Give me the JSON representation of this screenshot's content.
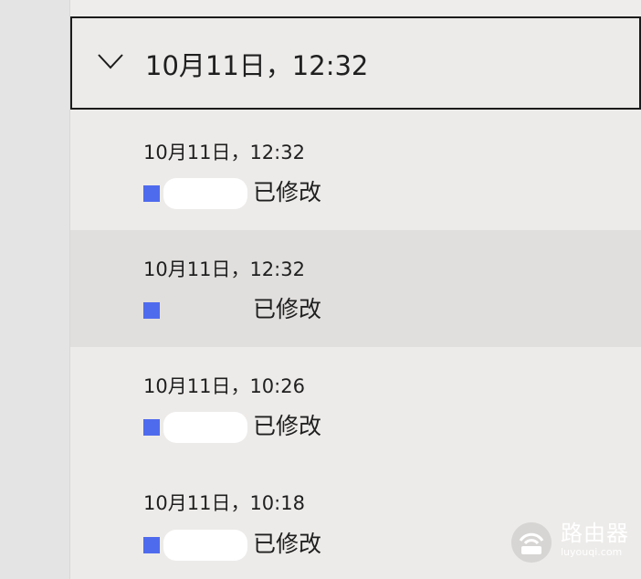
{
  "group": {
    "title": "10月11日，12:32"
  },
  "entries": [
    {
      "time": "10月11日，12:32",
      "status": "已修改"
    },
    {
      "time": "10月11日，12:32",
      "status": "已修改"
    },
    {
      "time": "10月11日，10:26",
      "status": "已修改"
    },
    {
      "time": "10月11日，10:18",
      "status": "已修改"
    }
  ],
  "watermark": {
    "title": "路由器",
    "subtitle": "luyouqi.com"
  },
  "colors": {
    "file_icon": "#4f6bed",
    "selected_row": "#e1dfdd",
    "panel": "#edebe9"
  }
}
